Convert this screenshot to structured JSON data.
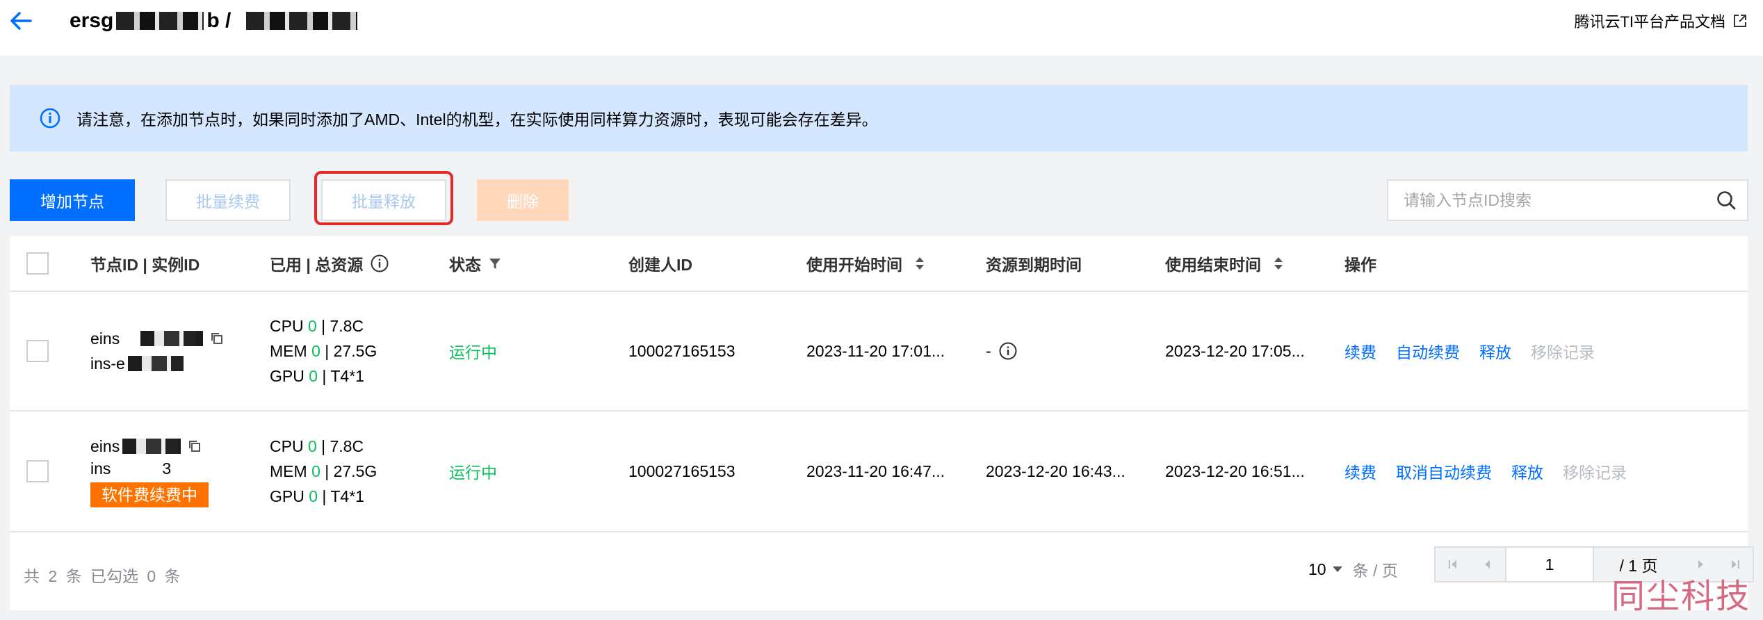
{
  "header": {
    "breadcrumb_start": "ersg",
    "breadcrumb_mid": "b /",
    "docs_link": "腾讯云TI平台产品文档"
  },
  "alert": {
    "text": "请注意，在添加节点时，如果同时添加了AMD、Intel的机型，在实际使用同样算力资源时，表现可能会存在差异。"
  },
  "toolbar": {
    "add_node": "增加节点",
    "batch_renew": "批量续费",
    "batch_release": "批量释放",
    "delete": "删除",
    "search_placeholder": "请输入节点ID搜索"
  },
  "table": {
    "columns": [
      "节点ID | 实例ID",
      "已用 | 总资源",
      "状态",
      "创建人ID",
      "使用开始时间",
      "资源到期时间",
      "使用结束时间",
      "操作"
    ],
    "rows": [
      {
        "node_id": "eins",
        "instance_id": "ins-e",
        "tag": "",
        "cpu_label": "CPU",
        "cpu_used": "0",
        "cpu_total": "| 7.8C",
        "mem_label": "MEM",
        "mem_used": "0",
        "mem_total": "| 27.5G",
        "gpu_label": "GPU",
        "gpu_used": "0",
        "gpu_total": "| T4*1",
        "status": "运行中",
        "creator": "100027165153",
        "start": "2023-11-20 17:01...",
        "expire": "-",
        "end": "2023-12-20 17:05...",
        "actions": [
          "续费",
          "自动续费",
          "释放",
          "移除记录"
        ]
      },
      {
        "node_id": "eins",
        "instance_id": "ins",
        "instance_suffix": "3",
        "tag": "软件费续费中",
        "cpu_label": "CPU",
        "cpu_used": "0",
        "cpu_total": "| 7.8C",
        "mem_label": "MEM",
        "mem_used": "0",
        "mem_total": "| 27.5G",
        "gpu_label": "GPU",
        "gpu_used": "0",
        "gpu_total": "| T4*1",
        "status": "运行中",
        "creator": "100027165153",
        "start": "2023-11-20 16:47...",
        "expire": "2023-12-20 16:43...",
        "end": "2023-12-20 16:51...",
        "actions": [
          "续费",
          "取消自动续费",
          "释放",
          "移除记录"
        ]
      }
    ]
  },
  "footer": {
    "summary": "共 2 条   已勾选 0 条",
    "page_size": "10",
    "page_size_unit": "条 / 页",
    "current_page": "1",
    "total_pages": "/ 1 页"
  },
  "watermark": "同尘科技",
  "colors": {
    "primary": "#006eff",
    "success": "#0abf5b",
    "warning": "#ff7200",
    "alert_bg": "#d5e7ff",
    "highlight_border": "#e32a2a"
  }
}
